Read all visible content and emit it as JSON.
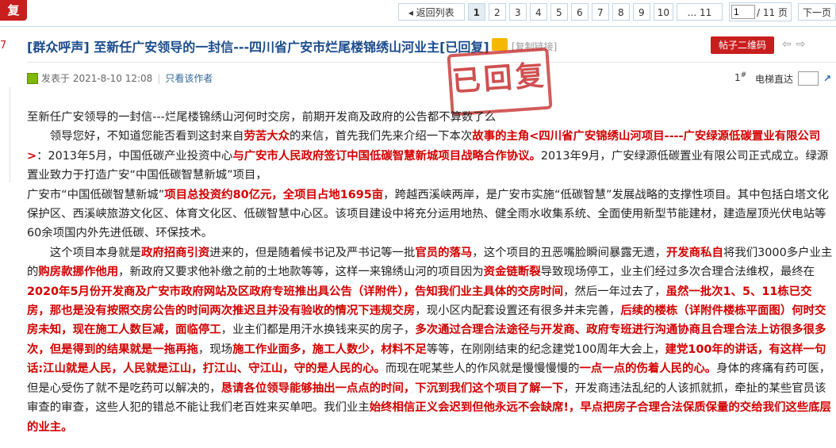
{
  "topbar": {
    "reply_label": "复",
    "back_label": "◂ 返回列表",
    "pages": [
      "1",
      "2",
      "3",
      "4",
      "5",
      "6",
      "7",
      "8",
      "9",
      "10"
    ],
    "last_page": "... 11",
    "page_input_value": "1",
    "page_total": "/ 11 页",
    "next_label": "下一页"
  },
  "left_number": "7",
  "thread": {
    "title": "[群众呼声] 至新任广安领导的一封信---四川省广安市烂尾楼锦绣山河业主[已回复]",
    "copy_link": "[复制链接]",
    "qr_label": "帖子二维码",
    "posted": "发表于 2021-8-10 12:08",
    "author_only": "只看该作者",
    "floor": "1",
    "floor_suffix": "#",
    "lift_label": "电梯直达",
    "stamp_text": "已回复"
  },
  "post": {
    "l1": "至新任广安领导的一封信---烂尾楼锦绣山河何时交房，前期开发商及政府的公告都不算数了么",
    "p2a": "领导您好，不知道您能否看到这封来自",
    "p2b": "劳苦大众",
    "p2c": "的来信，首先我们先来介绍一下本次",
    "p2d": "故事的主角<四川省广安锦绣山河项目----广安绿源低碳置业有限公司>",
    "p2e": "：2013年5月，中国低碳产业投资中心",
    "p2f": "与广安市人民政府签订中国低碳智慧新城项目战略合作协议。",
    "p2g": "2013年9月，广安绿源低碳置业有限公司正式成立。绿源置业致力于打造广安“中国低碳智慧新城”项目，",
    "p3a": "广安市“中国低碳智慧新城”",
    "p3b": "项目总投资约80亿元，全项目占地1695亩",
    "p3c": "，跨越西溪峡两岸，是广安市实施“低碳智慧”发展战略的支撑性项目。其中包括白塔文化保护区、西溪峡旅游文化区、体育文化区、低碳智慧中心区。该项目建设中将充分运用地热、健全雨水收集系统、全面使用新型节能建材，建造屋顶光伏电站等60余项国内外先进低碳、环保技术。",
    "p4a": "这个项目本身就是",
    "p4b": "政府招商引资",
    "p4c": "进来的，但是随着候书记及严书记等一批",
    "p4d": "官员的落马",
    "p4e": "，这个项目的丑恶嘴脸瞬间暴露无遗，",
    "p4f": "开发商私自",
    "p4g": "将我们3000多户业主的",
    "p4h": "购房款挪作他用",
    "p4i": "，新政府又要求他补缴之前的土地款等等，这样一来锦绣山河的项目因为",
    "p4j": "资金链断裂",
    "p4k": "导致现场停工，业主们经过多次合理合法维权，最终在",
    "p4l": "2020年5月份开发商及广安市政府网站及区政府专班推出具公告（详附件），告知我们业主具体的交房时间",
    "p4m": "，然后一年过去了，",
    "p4n": "虽然一批次1、5、11栋已交房，那也是没有按照交房公告的时间两次推迟且并没有验收的情况下违规交房",
    "p4o": "，现小区内配套设置还有很多并未完善，",
    "p4p": "后续的楼栋（详附件楼栋平面图）何时交房未知，现在施工人数巨减，面临停工",
    "p4q": "，业主们都是用汗水换钱来买的房子，",
    "p4r": "多次通过合理合法途径与开发商、政府专班进行沟通协商且合理合法上访很多很多次，但是得到的结果就是一拖再拖",
    "p4s": "，现场",
    "p4t": "施工作业面多，施工人数少，材料不足",
    "p4u": "等等，在刚刚结束的纪念建党100周年大会上，",
    "p4v": "建党100年的讲话，有这样一句话:江山就是人民，人民就是江山，打江山、守江山，守的是人民的心。",
    "p4w": "而现在呢某些人的作风就是慢慢慢慢的",
    "p4x": "一点一点的伤着人民的心。",
    "p4y": "身体的疼痛有药可医，但是心受伤了就不是吃药可以解决的，",
    "p4z": "恳请各位领导能够抽出一点点的时间，下沉到我们这个项目了解一下",
    "p4aa": "，开发商违法乱纪的人该抓就抓，牵扯的某些官员该审查的审查，这些人犯的错总不能让我们老百姓来买单吧。我们业主",
    "p4ab": "始终相信正义会迟到但他永远不会缺席!，早点把房子合理合法保质保量的交给我们这些底层的业主。"
  }
}
